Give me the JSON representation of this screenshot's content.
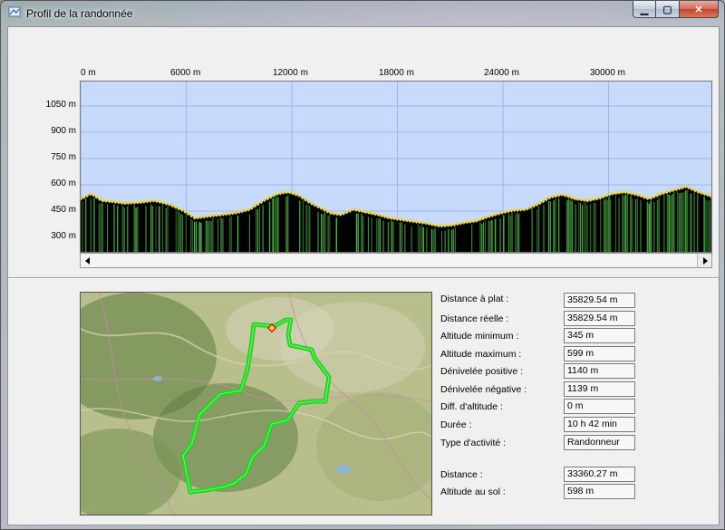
{
  "window": {
    "title": "Profil de la randonnée",
    "buttons": {
      "minimize": "▁",
      "maximize": "▢",
      "close": "✕"
    }
  },
  "colors": {
    "sky": "#c8dafc",
    "grid": "#9db5e8",
    "terrain": "#000000",
    "terrain_bars": "#4fb84a",
    "track_points": "#e8d64a",
    "route": "#1fd81f"
  },
  "chart_data": {
    "type": "area",
    "x_tick_labels": [
      "0 m",
      "6000 m",
      "12000 m",
      "18000 m",
      "24000 m",
      "30000 m"
    ],
    "y_tick_labels": [
      "1050 m",
      "900 m",
      "750 m",
      "600 m",
      "450 m",
      "300 m"
    ],
    "x_ticks": [
      0,
      6000,
      12000,
      18000,
      24000,
      30000
    ],
    "y_ticks": [
      1050,
      900,
      750,
      600,
      450,
      300
    ],
    "xlim": [
      0,
      36000
    ],
    "ylim": [
      200,
      1180
    ],
    "grid": true,
    "series": [
      {
        "x": [
          0,
          600,
          1200,
          1800,
          2500,
          3300,
          4200,
          5000,
          5800,
          6500,
          7200,
          8000,
          8800,
          9600,
          10400,
          11200,
          11800,
          12400,
          13000,
          13600,
          14200,
          14800,
          15500,
          16200,
          16900,
          17600,
          18300,
          19000,
          19700,
          20400,
          21100,
          21800,
          22500,
          23200,
          23900,
          24600,
          25300,
          26000,
          26700,
          27400,
          28100,
          28800,
          29500,
          30200,
          30900,
          31600,
          32300,
          33000,
          33700,
          34400,
          35100,
          35830
        ],
        "y": [
          520,
          550,
          510,
          505,
          495,
          500,
          510,
          490,
          455,
          410,
          420,
          430,
          440,
          460,
          510,
          550,
          560,
          540,
          500,
          470,
          440,
          430,
          460,
          445,
          430,
          410,
          400,
          390,
          380,
          365,
          370,
          385,
          395,
          420,
          440,
          455,
          460,
          490,
          530,
          545,
          520,
          510,
          525,
          550,
          560,
          545,
          520,
          550,
          570,
          590,
          560,
          535
        ]
      }
    ]
  },
  "stats": [
    {
      "label": "Distance à plat :",
      "value": "35829.54 m"
    },
    {
      "label": "Distance réelle :",
      "value": "35829.54 m"
    },
    {
      "label": "Altitude minimum :",
      "value": "345 m"
    },
    {
      "label": "Altitude maximum :",
      "value": "599 m"
    },
    {
      "label": "Dénivelée positive :",
      "value": "1140 m"
    },
    {
      "label": "Dénivelée négative :",
      "value": "1139 m"
    },
    {
      "label": "Diff. d'altitude :",
      "value": "0 m"
    },
    {
      "label": "Durée :",
      "value": "10 h 42 min"
    },
    {
      "label": "Type d'activité :",
      "value": "Randonneur"
    },
    {
      "label": "Distance :",
      "value": "33360.27 m"
    },
    {
      "label": "Altitude au sol :",
      "value": "598 m"
    }
  ]
}
